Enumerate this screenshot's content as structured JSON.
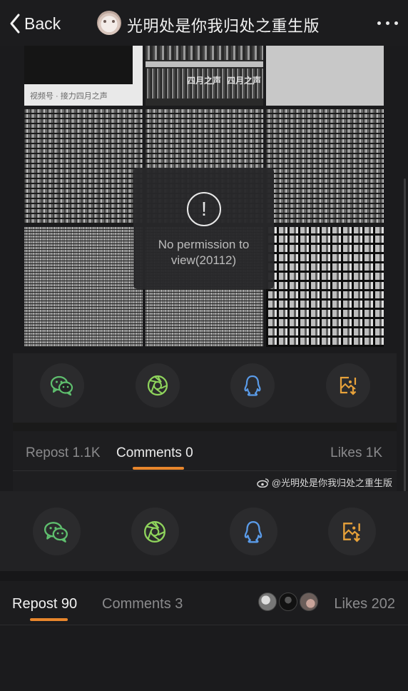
{
  "nav": {
    "back_label": "Back",
    "title": "光明处是你我归处之重生版"
  },
  "media": {
    "tile_caption": "视频号 · 接力四月之声",
    "mini_label_1": "四月之声",
    "mini_label_2": "四月之声"
  },
  "permission": {
    "icon": "!",
    "message": "No permission to view(20112)"
  },
  "share_icons": [
    "wechat-icon",
    "moments-icon",
    "qq-icon",
    "save-image-icon"
  ],
  "share_colors": {
    "wechat": "#5fbf6e",
    "moments": "#8fd45c",
    "qq": "#5a9be8",
    "save": "#e8a23a"
  },
  "tabs_embedded": {
    "repost": "Repost 1.1K",
    "comments": "Comments 0",
    "likes": "Likes 1K"
  },
  "watermark": "@光明处是你我归处之重生版",
  "tabs_main": {
    "repost": "Repost 90",
    "comments": "Comments 3",
    "likes": "Likes 202"
  },
  "accent_color": "#e8862c"
}
